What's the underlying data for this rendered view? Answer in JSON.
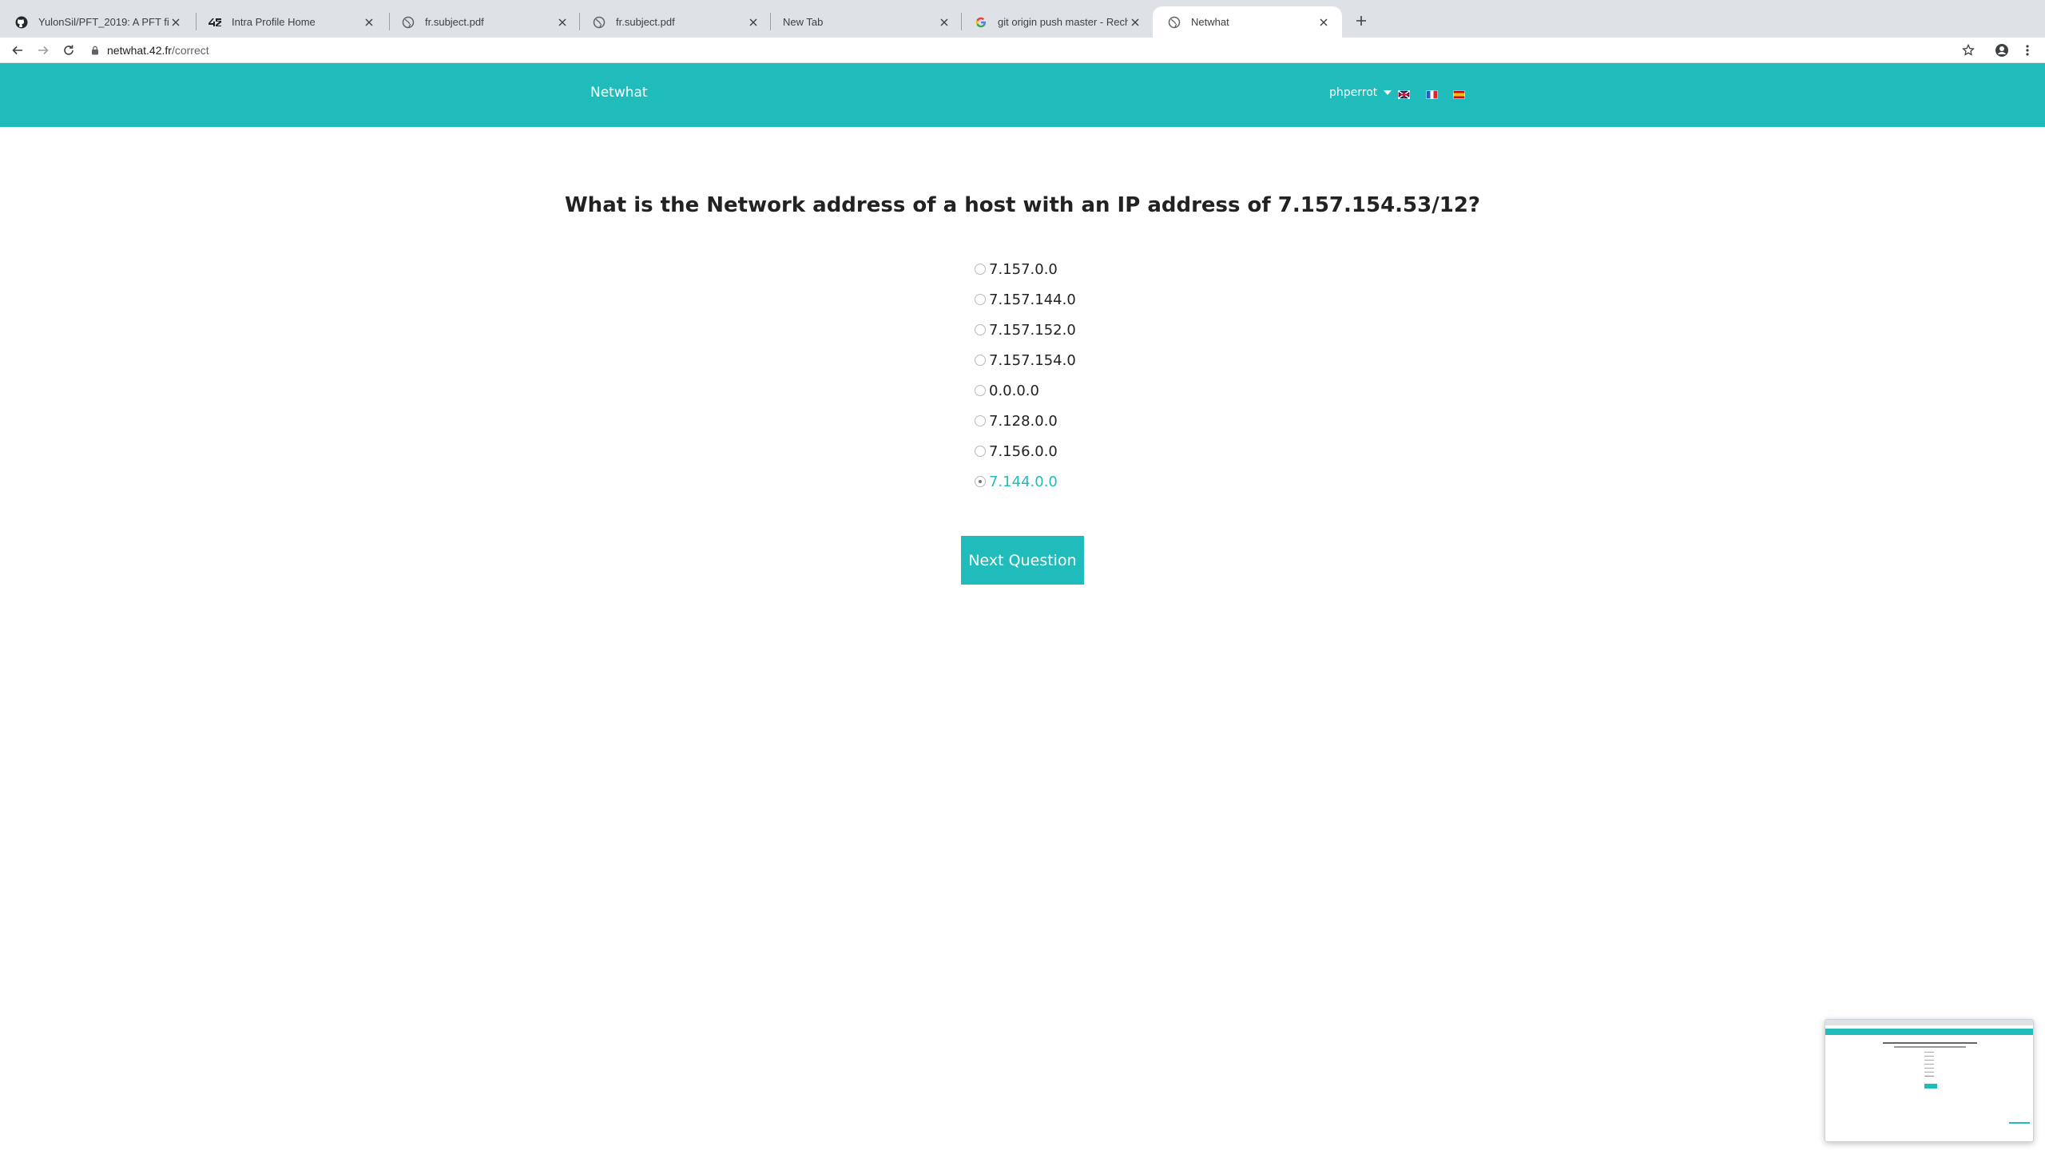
{
  "browser": {
    "tabs": [
      {
        "title": "YulonSil/PFT_2019: A PFT file t",
        "icon": "github-icon"
      },
      {
        "title": "Intra Profile Home",
        "icon": "42-logo-icon"
      },
      {
        "title": "fr.subject.pdf",
        "icon": "globe-icon"
      },
      {
        "title": "fr.subject.pdf",
        "icon": "globe-icon"
      },
      {
        "title": "New Tab",
        "icon": ""
      },
      {
        "title": "git origin push master - Recher",
        "icon": "google-icon"
      },
      {
        "title": "Netwhat",
        "icon": "globe-icon",
        "active": true
      }
    ],
    "url_host": "netwhat.42.fr",
    "url_path": "/correct"
  },
  "navbar": {
    "brand": "Netwhat",
    "user": "phperrot",
    "flags": [
      "uk-flag",
      "fr-flag",
      "es-flag"
    ],
    "accent": "#20bcbc"
  },
  "quiz": {
    "question": "What is the Network address of a host with an IP address of 7.157.154.53/12?",
    "answers": [
      {
        "label": "7.157.0.0"
      },
      {
        "label": "7.157.144.0"
      },
      {
        "label": "7.157.152.0"
      },
      {
        "label": "7.157.154.0"
      },
      {
        "label": "0.0.0.0"
      },
      {
        "label": "7.128.0.0"
      },
      {
        "label": "7.156.0.0"
      },
      {
        "label": "7.144.0.0",
        "selected": true
      }
    ],
    "next_label": "Next Question"
  }
}
